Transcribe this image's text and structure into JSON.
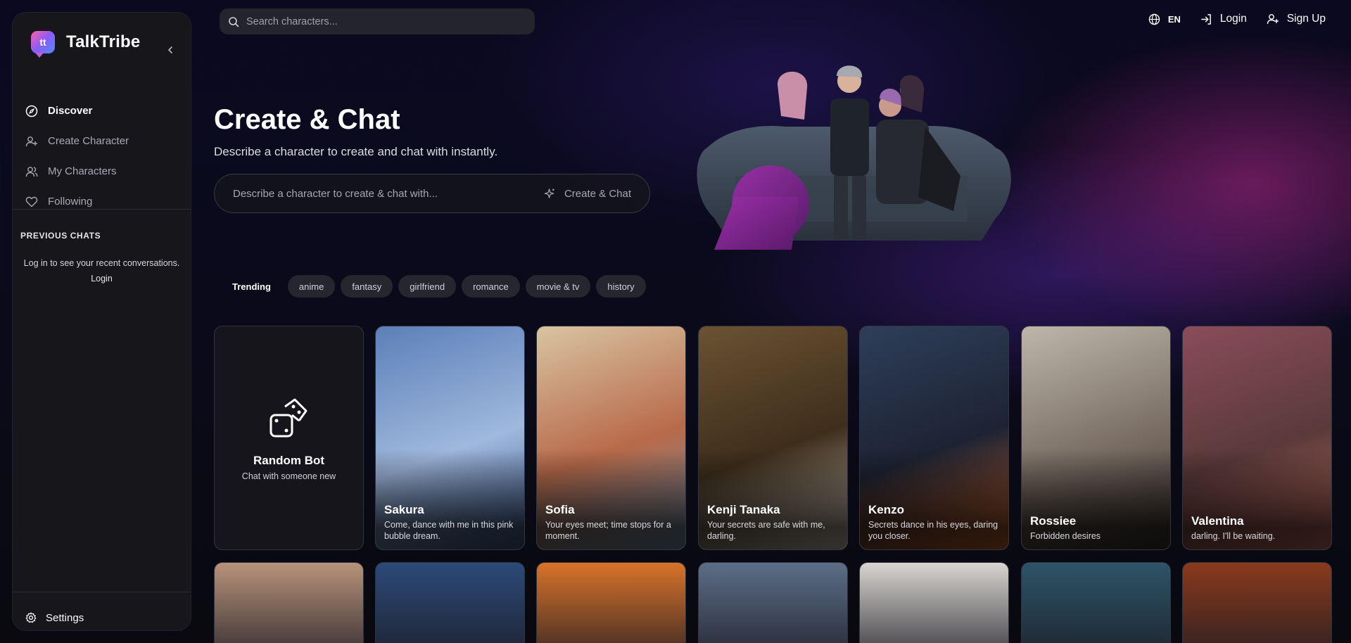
{
  "brand": {
    "name": "TalkTribe",
    "logo_text": "tt"
  },
  "nav": {
    "items": [
      {
        "label": "Discover",
        "icon": "compass-icon",
        "active": true
      },
      {
        "label": "Create Character",
        "icon": "user-plus-icon",
        "active": false
      },
      {
        "label": "My Characters",
        "icon": "users-icon",
        "active": false
      },
      {
        "label": "Following",
        "icon": "heart-icon",
        "active": false
      }
    ]
  },
  "previous_chats": {
    "title": "PREVIOUS CHATS",
    "message": "Log in to see your recent conversations.",
    "login_label": "Login"
  },
  "settings_label": "Settings",
  "search": {
    "placeholder": "Search characters..."
  },
  "topbar": {
    "lang": "EN",
    "login": "Login",
    "signup": "Sign Up"
  },
  "hero": {
    "title": "Create & Chat",
    "subtitle": "Describe a character to create and chat with instantly.",
    "input_placeholder": "Describe a character to create & chat with...",
    "button_label": "Create & Chat"
  },
  "trending": {
    "label": "Trending",
    "tags": [
      "anime",
      "fantasy",
      "girlfriend",
      "romance",
      "movie & tv",
      "history"
    ]
  },
  "random_bot": {
    "name": "Random Bot",
    "desc": "Chat with someone new"
  },
  "characters": [
    {
      "name": "Sakura",
      "tagline": "Come, dance with me in this pink bubble dream.",
      "bg": [
        "#5b7fb8",
        "#9fb8dd",
        "#3e5a8c"
      ]
    },
    {
      "name": "Sofia",
      "tagline": "Your eyes meet; time stops for a moment.",
      "bg": [
        "#d8c4a2",
        "#b86a4a",
        "#6f8fa8"
      ]
    },
    {
      "name": "Kenji Tanaka",
      "tagline": "Your secrets are safe with me, darling.",
      "bg": [
        "#6b5232",
        "#3e2e1c",
        "#cfc6b8"
      ]
    },
    {
      "name": "Kenzo",
      "tagline": "Secrets dance in his eyes, daring you closer.",
      "bg": [
        "#2e3e5a",
        "#1d2333",
        "#c8642c"
      ]
    },
    {
      "name": "Rossiee",
      "tagline": "Forbidden desires",
      "bg": [
        "#bdb6ab",
        "#7a6e64",
        "#3a322d"
      ]
    },
    {
      "name": "Valentina",
      "tagline": "darling. I'll be waiting.",
      "bg": [
        "#8a4c5a",
        "#5a3a3a",
        "#c26e60"
      ]
    }
  ],
  "row2_colors": [
    "#b8927a",
    "#2c4a78",
    "#d9732a",
    "#5c6e88",
    "#d8d4d0",
    "#2d5468",
    "#8a3a1c"
  ]
}
